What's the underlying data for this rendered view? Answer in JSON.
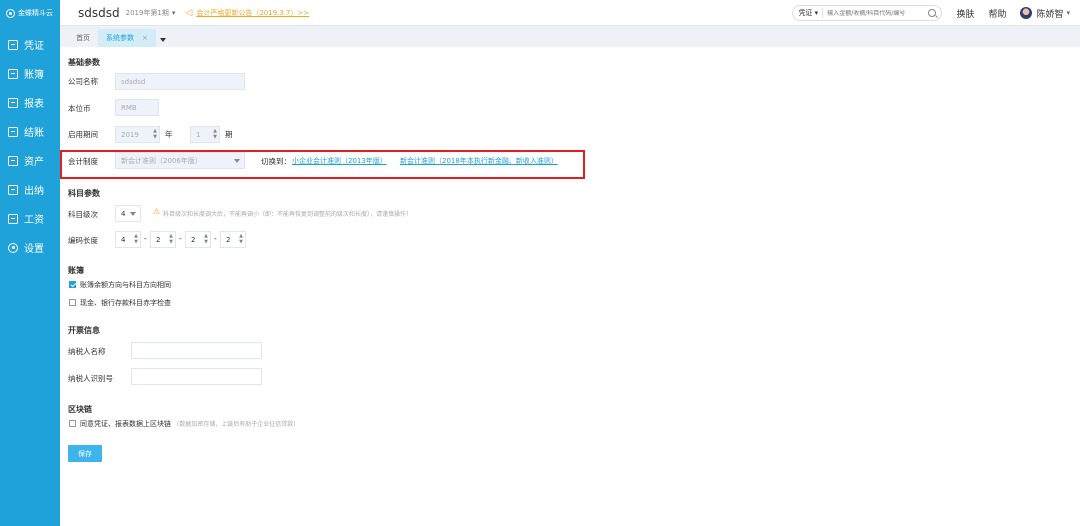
{
  "sidebar": {
    "logo_text": "金蝶精斗云",
    "items": [
      {
        "label": "凭证",
        "icon": "voucher-icon"
      },
      {
        "label": "账簿",
        "icon": "ledger-icon"
      },
      {
        "label": "报表",
        "icon": "report-icon"
      },
      {
        "label": "结账",
        "icon": "checkout-icon"
      },
      {
        "label": "资产",
        "icon": "asset-icon"
      },
      {
        "label": "出纳",
        "icon": "cashier-icon"
      },
      {
        "label": "工资",
        "icon": "salary-icon"
      },
      {
        "label": "设置",
        "icon": "gear-icon"
      }
    ]
  },
  "header": {
    "company": "sdsdsd",
    "period": "2019年第1期",
    "notice": "会计严格更新公告（2019.3.7）>>",
    "search_type": "凭证",
    "search_placeholder": "输入金额/收摘/科目代码/编号",
    "skin": "换肤",
    "help": "帮助",
    "user": "陈娇智"
  },
  "tabs": {
    "home": "首页",
    "active": "系统参数",
    "close": "×"
  },
  "form": {
    "basic_section": "基础参数",
    "company_label": "公司名称",
    "company_value": "sdsdsd",
    "currency_label": "本位币",
    "currency_value": "RMB",
    "period_label": "启用期间",
    "year_value": "2019",
    "year_unit": "年",
    "month_value": "1",
    "month_unit": "期",
    "acct_system_label": "会计制度",
    "acct_system_value": "新会计准则（2006年版）",
    "switch_label": "切换到：",
    "switch_option1": "小企业会计准则（2013年版）",
    "switch_option2": "新会计准则（2018年本执行新金融、新收入准则）",
    "subject_section": "科目参数",
    "subject_level_label": "科目级次",
    "subject_level_value": "4",
    "subject_warning": "科目级次和长度调大后，不能再调小（即：不能再恢复到调整前的级次和长度），请谨慎操作！",
    "code_length_label": "编码长度",
    "code_lengths": [
      "4",
      "2",
      "2",
      "2"
    ],
    "code_sep": "-",
    "ledger_section": "账簿",
    "ledger_check1": "账簿余额方向与科目方向相同",
    "ledger_check2": "现金、银行存款科目赤字检查",
    "invoice_section": "开票信息",
    "taxpayer_name_label": "纳税人名称",
    "taxpayer_id_label": "纳税人识别号",
    "blockchain_section": "区块链",
    "blockchain_check": "同意凭证、报表数据上区块链",
    "blockchain_note": "（数据加密存储，上链后有助于企业征信贷款）",
    "save": "保存"
  },
  "colors": {
    "sidebar": "#1fa1d9",
    "accent": "#1fa1d9",
    "highlight": "#e02020",
    "warning": "#f5a623"
  }
}
